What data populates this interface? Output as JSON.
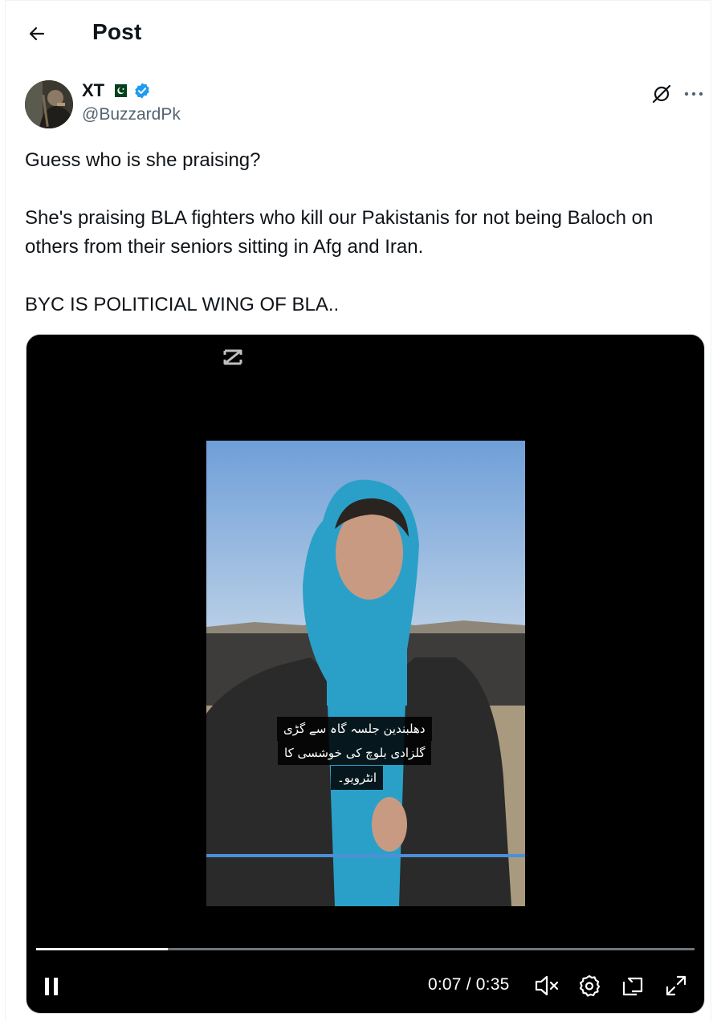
{
  "header": {
    "title": "Post"
  },
  "author": {
    "name": "XT",
    "handle": "@BuzzardPk",
    "flag_colors": {
      "green": "#01411c",
      "white": "#ffffff"
    },
    "verified_color": "#1d9bf0"
  },
  "post": {
    "paragraphs": [
      "Guess who is she praising?",
      "She's praising BLA fighters who kill our Pakistanis for not being Baloch on others from their seniors sitting in Afg and Iran.",
      "BYC IS POLITICIAL WING OF BLA.."
    ]
  },
  "video": {
    "subtitle_lines": [
      "دھلبندین جلسہ گاہ سے گڑی",
      "گلزادی بلوچ کی خوشسی کا",
      "انٹرویو۔"
    ],
    "current_time": "0:07",
    "duration": "0:35",
    "time_display": "0:07 / 0:35",
    "progress": 0.2,
    "playing": true,
    "muted": true
  },
  "icons": {
    "back": "arrow-left-icon",
    "grok": "grok-icon",
    "more": "more-horizontal-icon",
    "pause": "pause-icon",
    "mute": "volume-muted-icon",
    "settings": "gear-icon",
    "pip": "picture-in-picture-icon",
    "fullscreen": "fullscreen-icon"
  }
}
